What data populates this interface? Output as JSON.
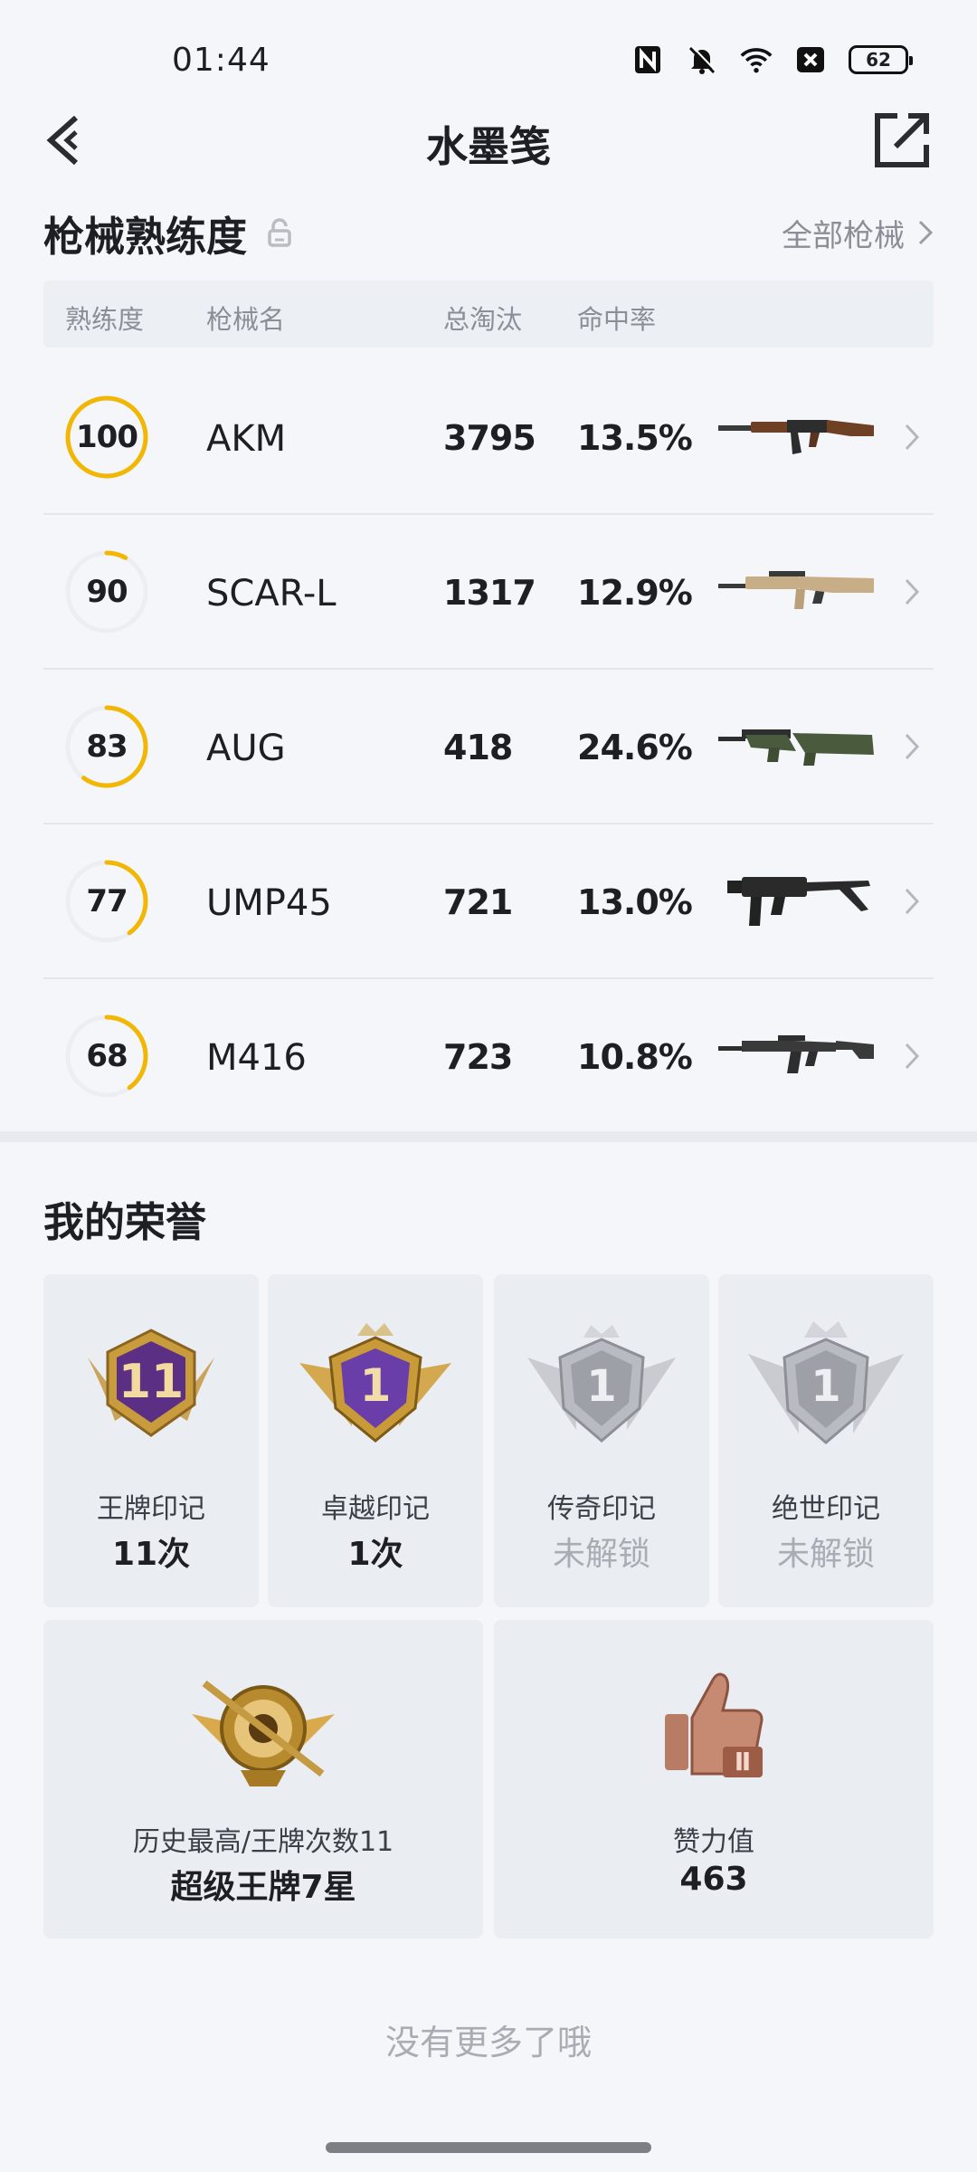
{
  "status_bar": {
    "time": "01:44",
    "battery": "62",
    "icons": [
      "nfc-icon",
      "mute-icon",
      "wifi-icon",
      "sim-off-icon",
      "battery-icon"
    ]
  },
  "header": {
    "title": "水墨笺",
    "back_icon": "back-arrow-icon",
    "share_icon": "share-icon"
  },
  "weapons": {
    "title": "枪械熟练度",
    "lock_icon": "lock-icon",
    "see_all": "全部枪械",
    "columns": [
      "熟练度",
      "枪械名",
      "总淘汰",
      "命中率"
    ],
    "ring_color": "#f2b705",
    "rows": [
      {
        "proficiency": "100",
        "progress": 1.0,
        "name": "AKM",
        "kills": "3795",
        "accuracy": "13.5%",
        "image": "akm-rifle"
      },
      {
        "proficiency": "90",
        "progress": 0.08,
        "name": "SCAR-L",
        "kills": "1317",
        "accuracy": "12.9%",
        "image": "scar-l-rifle"
      },
      {
        "proficiency": "83",
        "progress": 0.6,
        "name": "AUG",
        "kills": "418",
        "accuracy": "24.6%",
        "image": "aug-rifle"
      },
      {
        "proficiency": "77",
        "progress": 0.4,
        "name": "UMP45",
        "kills": "721",
        "accuracy": "13.0%",
        "image": "ump45-smg"
      },
      {
        "proficiency": "68",
        "progress": 0.4,
        "name": "M416",
        "kills": "723",
        "accuracy": "10.8%",
        "image": "m416-rifle"
      }
    ]
  },
  "honors": {
    "title": "我的荣誉",
    "cards": [
      {
        "label": "王牌印记",
        "value": "11次",
        "badge_text": "11",
        "locked": false,
        "badge": "ace-mark-badge"
      },
      {
        "label": "卓越印记",
        "value": "1次",
        "badge_text": "1",
        "locked": false,
        "badge": "excellence-mark-badge"
      },
      {
        "label": "传奇印记",
        "value": "未解锁",
        "badge_text": "1",
        "locked": true,
        "badge": "legend-mark-badge"
      },
      {
        "label": "绝世印记",
        "value": "未解锁",
        "badge_text": "1",
        "locked": true,
        "badge": "peerless-mark-badge"
      }
    ],
    "wide_cards": [
      {
        "label": "历史最高/王牌次数11",
        "value": "超级王牌7星",
        "badge": "rank-emblem-badge"
      },
      {
        "label": "赞力值",
        "value": "463",
        "badge": "thumbs-up-badge",
        "badge_text": "Ⅱ"
      }
    ]
  },
  "footer": {
    "no_more": "没有更多了哦"
  }
}
